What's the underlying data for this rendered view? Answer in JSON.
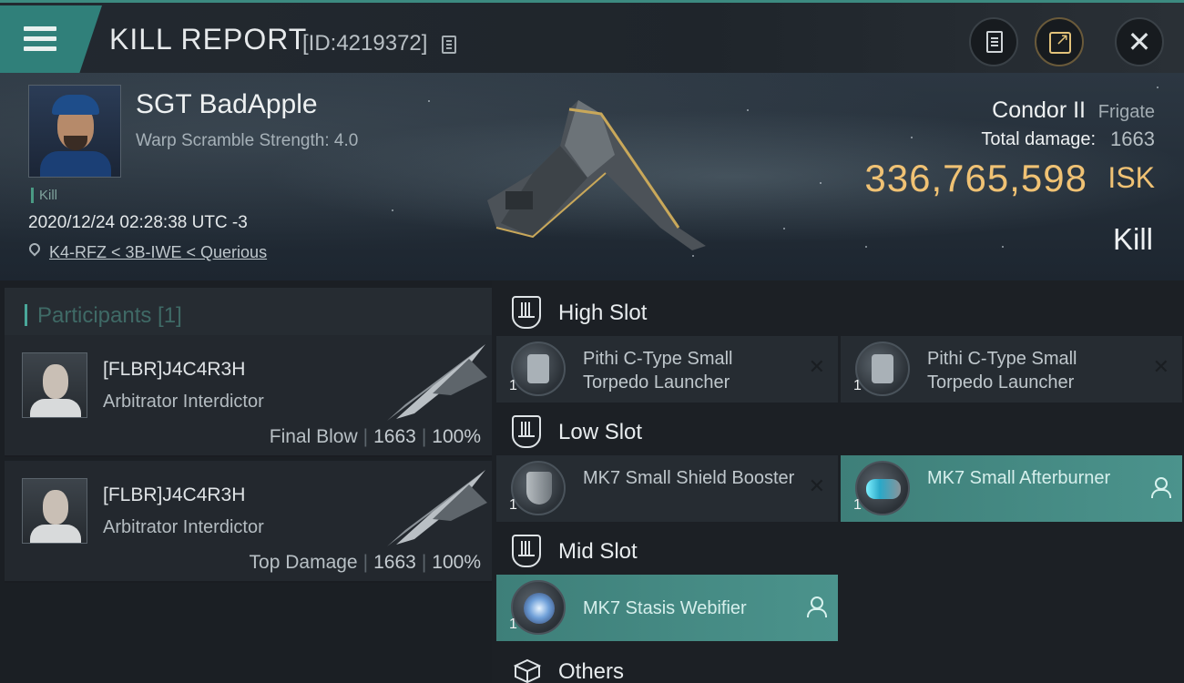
{
  "header": {
    "title": "KILL REPORT",
    "report_id": "[ID:4219372]"
  },
  "victim": {
    "name": "SGT BadApple",
    "warp_scramble": "Warp Scramble Strength: 4.0",
    "tag": "Kill",
    "timestamp": "2020/12/24 02:28:38 UTC -3",
    "location": "K4-RFZ < 3B-IWE < Querious",
    "ship": "Condor II",
    "ship_class": "Frigate",
    "total_damage_label": "Total damage:",
    "total_damage": "1663",
    "isk_value": "336,765,598",
    "isk_unit": "ISK",
    "result": "Kill"
  },
  "participants": {
    "label": "Participants [1]",
    "rows": [
      {
        "name": "[FLBR]J4C4R3H",
        "ship": "Arbitrator Interdictor",
        "role": "Final Blow",
        "damage": "1663",
        "percent": "100%"
      },
      {
        "name": "[FLBR]J4C4R3H",
        "ship": "Arbitrator Interdictor",
        "role": "Top Damage",
        "damage": "1663",
        "percent": "100%"
      }
    ]
  },
  "fitting": {
    "high_slot": "High Slot",
    "low_slot": "Low Slot",
    "mid_slot": "Mid Slot",
    "others": "Others",
    "high": [
      {
        "qty": "1",
        "name": "Pithi C-Type Small Torpedo Launcher",
        "status": "destroyed"
      },
      {
        "qty": "1",
        "name": "Pithi C-Type Small Torpedo Launcher",
        "status": "destroyed"
      }
    ],
    "low": [
      {
        "qty": "1",
        "name": "MK7 Small Shield Booster",
        "status": "destroyed"
      },
      {
        "qty": "1",
        "name": "MK7 Small Afterburner",
        "status": "dropped"
      }
    ],
    "mid": [
      {
        "qty": "1",
        "name": "MK7 Stasis Webifier",
        "status": "dropped"
      }
    ]
  },
  "icons": {
    "menu": "hamburger-icon",
    "copy": "copy-icon",
    "clipboard": "clipboard-icon",
    "share": "share-icon",
    "close": "close-icon",
    "location": "location-pin-icon",
    "slot": "slot-shield-icon",
    "others": "cube-icon",
    "destroyed": "x-mark-icon",
    "dropped": "user-icon"
  },
  "colors": {
    "accent": "#30807a",
    "isk": "#f0c274",
    "active_module": "#4b938c"
  }
}
